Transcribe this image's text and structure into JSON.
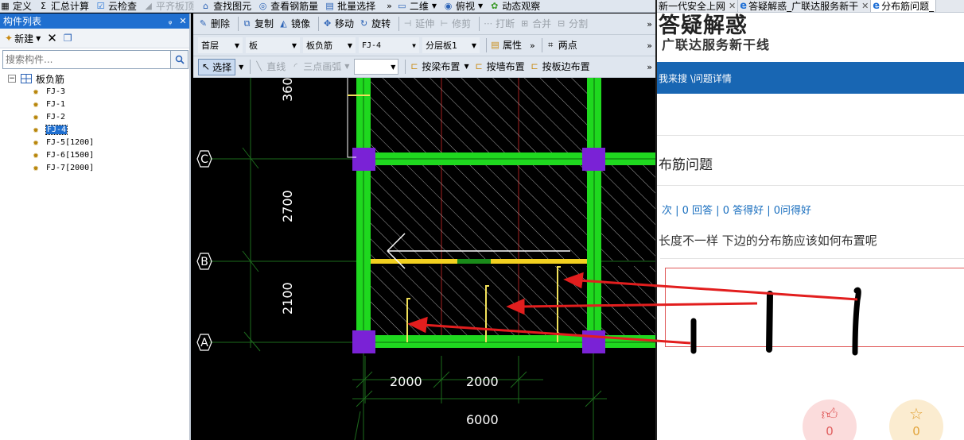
{
  "menu": {
    "items": [
      {
        "label": "定义",
        "icon": "define-icon",
        "glyph": "▦",
        "disabled": false
      },
      {
        "label": "汇总计算",
        "icon": "sigma-icon",
        "glyph": "Σ",
        "disabled": false
      },
      {
        "label": "云检查",
        "icon": "cloud-check-icon",
        "glyph": "☑",
        "disabled": false
      },
      {
        "label": "平齐板顶",
        "icon": "align-slab-top-icon",
        "glyph": "◢",
        "disabled": true
      },
      {
        "label": "查找图元",
        "icon": "find-element-icon",
        "glyph": "⌂",
        "disabled": false
      },
      {
        "label": "查看钢筋量",
        "icon": "view-rebar-icon",
        "glyph": "◎",
        "disabled": false
      },
      {
        "label": "批量选择",
        "icon": "batch-select-icon",
        "glyph": "▤",
        "disabled": false
      }
    ],
    "more": "»",
    "view_items": [
      {
        "label": "二维",
        "icon": "two-d-icon",
        "glyph": "▭"
      },
      {
        "label": "俯视",
        "icon": "top-view-icon",
        "glyph": "◉"
      },
      {
        "label": "动态观察",
        "icon": "orbit-view-icon",
        "glyph": "✿"
      }
    ]
  },
  "left_panel": {
    "title": "构件列表",
    "pin": "ᵩ",
    "close": "✕",
    "new_label": "新建",
    "search_placeholder": "搜索构件...",
    "tree_root": "板负筋",
    "tree_toggle": "⊟",
    "items": [
      "FJ-3",
      "FJ-1",
      "FJ-2",
      "FJ-4",
      "FJ-5[1200]",
      "FJ-6[1500]",
      "FJ-7[2000]"
    ],
    "selected": "FJ-4"
  },
  "toolbar1": {
    "delete": "删除",
    "copy": "复制",
    "mirror": "镜像",
    "move": "移动",
    "rotate": "旋转",
    "extend": "延伸",
    "trim": "修剪",
    "break": "打断",
    "merge": "合并",
    "split": "分割"
  },
  "toolbar2": {
    "floor": "首层",
    "category": "板",
    "type": "板负筋",
    "component": "FJ-4",
    "layer": "分层板1",
    "properties": "属性",
    "two_points": "两点"
  },
  "toolbar3": {
    "select": "选择",
    "line": "直线",
    "arc": "三点画弧",
    "by_beam": "按梁布置",
    "by_wall": "按墙布置",
    "by_slab_edge": "按板边布置"
  },
  "cad": {
    "axis_labels": [
      "C",
      "B",
      "A"
    ],
    "dim_vertical": [
      "360",
      "2700",
      "2100"
    ],
    "dim_horizontal": [
      "2000",
      "2000",
      "6000"
    ]
  },
  "browser": {
    "tabs": [
      {
        "label": "新一代安全上网",
        "active": false
      },
      {
        "label": "答疑解惑_广联达服务新干",
        "active": false
      },
      {
        "label": "分布筋问题_",
        "active": true
      }
    ],
    "site_title": "答疑解惑",
    "site_subtitle": "广联达服务新干线",
    "breadcrumb": "我来搜 \\问题详情",
    "question_title": "布筋问题",
    "question_stats": "次 | 0 回答 | 0 答得好 | 0问得好",
    "question_body": "长度不一样  下边的分布筋应该如何布置呢",
    "like_count": "0",
    "fav_count": "0"
  },
  "colors": {
    "beam": "#1fd81f",
    "column": "#7a22d6",
    "rebar": "#f2e15a",
    "axis": "#1d6b1d",
    "arrow": "#e21e1e",
    "nav_blue": "#1866b3"
  }
}
